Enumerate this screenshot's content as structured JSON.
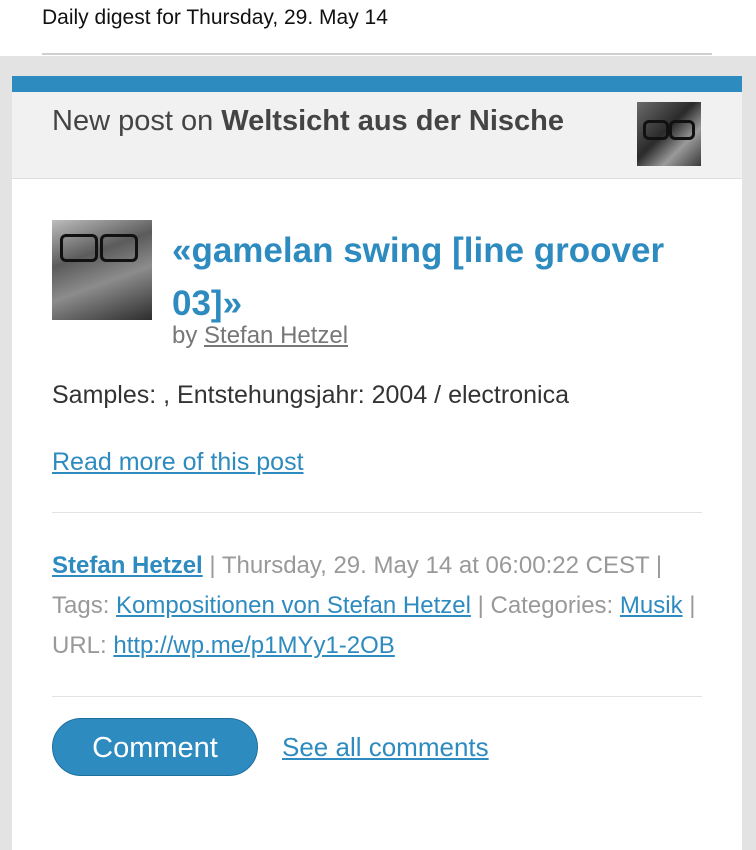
{
  "digest": {
    "title": "Daily digest for Thursday, 29. May 14"
  },
  "card_header": {
    "prefix": "New post on ",
    "blog_name": "Weltsicht aus der Nische"
  },
  "post": {
    "title": "«gamelan swing [line groover 03]»",
    "by_label": "by ",
    "author": "Stefan Hetzel",
    "excerpt": "Samples: , Entstehungsjahr: 2004 / electronica",
    "read_more": "Read more of this post"
  },
  "meta": {
    "author": "Stefan Hetzel",
    "date_text": " | Thursday, 29. May 14 at 06:00:22 CEST",
    "tags_label": " | Tags: ",
    "tag": "Kompositionen von Stefan Hetzel",
    "categories_label": " | Categories: ",
    "category": "Musik",
    "url_label": " | URL: ",
    "url": "http://wp.me/p1MYy1-2OB"
  },
  "actions": {
    "comment": "Comment",
    "see_all": "See all comments"
  },
  "colors": {
    "accent": "#2e8bc0",
    "header_bg": "#f1f1f1",
    "outer_bg": "#e3e3e3"
  }
}
